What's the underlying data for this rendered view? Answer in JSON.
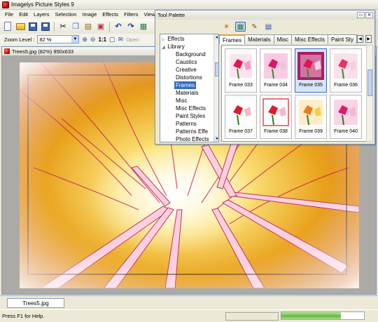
{
  "app": {
    "title": "Imagelys Picture Styles 9"
  },
  "menu": [
    "File",
    "Edit",
    "Layers",
    "Selection",
    "Image",
    "Effects",
    "Filters",
    "View",
    "W"
  ],
  "zoom": {
    "label": "Zoom Level :",
    "value": "82 %",
    "ratio_label": "1:1",
    "open_label": "Open"
  },
  "document": {
    "title": "Trees5.jpg (82%) 950x633",
    "tab_label": "Trees5.jpg"
  },
  "status": {
    "text": "Press F1 for Help.",
    "progress_fraction": 0.72
  },
  "palette": {
    "title": "Tool Palette",
    "tree": {
      "root": "Effects",
      "library": "Library",
      "items": [
        "Background",
        "Caustics",
        "Creative",
        "Distortions",
        "Frames",
        "Materials",
        "Misc",
        "Misc Effects",
        "Paint Styles",
        "Patterns",
        "Patterns Effe",
        "Photo Effects"
      ],
      "selected": "Frames"
    },
    "tabs": [
      "Frames",
      "Materials",
      "Misc",
      "Misc Effects",
      "Paint Sty"
    ],
    "active_tab": "Frames",
    "frames": [
      {
        "label": "Frame 033",
        "style": "Magenta"
      },
      {
        "label": "Frame 034",
        "style": "Pink"
      },
      {
        "label": "Frame 035",
        "style": "Deep"
      },
      {
        "label": "Frame 036",
        "style": "Soft"
      },
      {
        "label": "Frame 037",
        "style": "Red"
      },
      {
        "label": "Frame 038",
        "style": "Red"
      },
      {
        "label": "Frame 039",
        "style": "Orange"
      },
      {
        "label": "Frame 040",
        "style": "Pink"
      }
    ],
    "selected_frame": "Frame 035"
  },
  "colors": {
    "accent": "#316ac5",
    "tab_highlight": "#e7a13a",
    "progress": "#5fbf3d"
  }
}
